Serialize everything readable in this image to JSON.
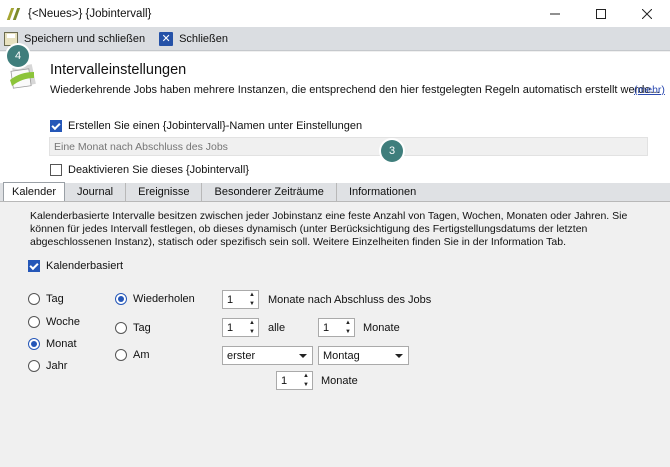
{
  "window": {
    "title": "{<Neues>} {Jobintervall}"
  },
  "toolbar": {
    "save_label": "Speichern und schließen",
    "close_label": "Schließen"
  },
  "badges": {
    "save_step": "4",
    "name_step": "3"
  },
  "header": {
    "title": "Intervalleinstellungen",
    "description": "Wiederkehrende Jobs haben mehrere Instanzen, die entsprechend den hier festgelegten Regeln automatisch erstellt werde...",
    "more_link": "(mehr)",
    "create_name_label": "Erstellen Sie einen {Jobintervall}-Namen unter Einstellungen",
    "create_name_checked": true,
    "name_placeholder": "Eine Monat nach Abschluss des Jobs",
    "deactivate_label": "Deaktivieren Sie dieses {Jobintervall}",
    "deactivate_checked": false
  },
  "tabs": [
    {
      "label": "Kalender",
      "active": true
    },
    {
      "label": "Journal",
      "active": false
    },
    {
      "label": "Ereignisse",
      "active": false
    },
    {
      "label": "Besonderer Zeiträume",
      "active": false
    },
    {
      "label": "Informationen",
      "active": false
    }
  ],
  "calendar": {
    "description": "Kalenderbasierte Intervalle besitzen zwischen jeder Jobinstanz eine feste Anzahl von Tagen, Wochen, Monaten oder Jahren. Sie können für jedes Intervall festlegen, ob dieses dynamisch (unter Berücksichtigung des Fertigstellungsdatums der letzten abgeschlossenen Instanz), statisch oder spezifisch sein soll. Weitere Einzelheiten finden Sie in der Information Tab.",
    "calendar_based_label": "Kalenderbasiert",
    "calendar_based_checked": true,
    "units": [
      {
        "label": "Tag",
        "checked": false
      },
      {
        "label": "Woche",
        "checked": false
      },
      {
        "label": "Monat",
        "checked": true
      },
      {
        "label": "Jahr",
        "checked": false
      }
    ],
    "modes": [
      {
        "label": "Wiederholen",
        "checked": true
      },
      {
        "label": "Tag",
        "checked": false
      },
      {
        "label": "Am",
        "checked": false
      }
    ],
    "repeat": {
      "value": "1",
      "suffix": "Monate nach Abschluss des Jobs"
    },
    "day": {
      "value": "1",
      "every_label": "alle",
      "months_value": "1",
      "months_label": "Monate"
    },
    "on": {
      "ordinal": "erster",
      "weekday": "Montag",
      "months_value": "1",
      "months_label": "Monate"
    }
  }
}
